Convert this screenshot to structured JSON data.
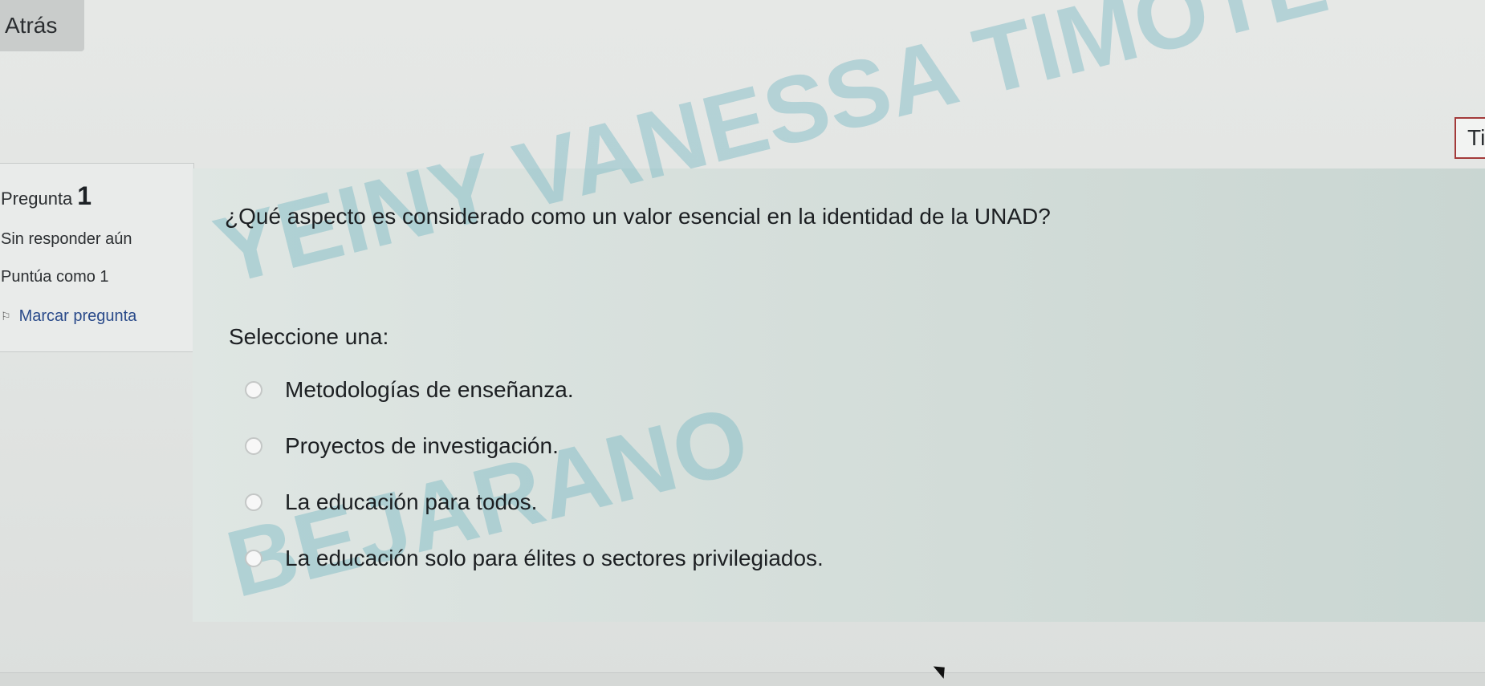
{
  "nav": {
    "back_label": "Atrás"
  },
  "timer": {
    "label": "Ti"
  },
  "info": {
    "question_label": "Pregunta",
    "question_number": "1",
    "status": "Sin responder aún",
    "points": "Puntúa como 1",
    "flag_label": "Marcar pregunta"
  },
  "question": {
    "text": "¿Qué aspecto es considerado como un valor esencial en la identidad de la UNAD?",
    "select_label": "Seleccione una:",
    "options": [
      "Metodologías de enseñanza.",
      "Proyectos de investigación.",
      "La educación para todos.",
      "La educación solo para élites o sectores privilegiados."
    ]
  },
  "watermark": {
    "line1": "YEINY VANESSA TIMOTE",
    "line2": "BEJARANO",
    "color": "#78b9c3"
  },
  "icons": {
    "flag": "flag-outline-icon",
    "radio": "radio-empty-icon",
    "cursor": "mouse-pointer-icon"
  }
}
